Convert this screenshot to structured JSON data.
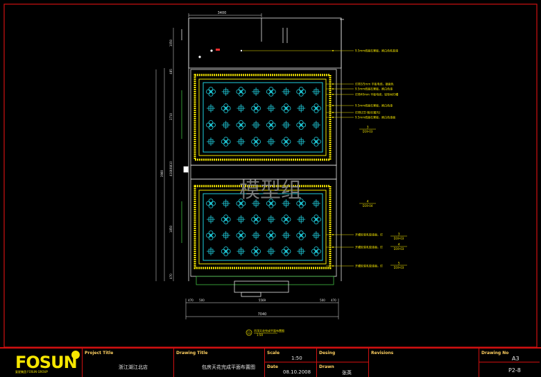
{
  "watermark": "模型组",
  "plan_title": "吊顶天花完成平面布置图",
  "plan_scale": "1:50",
  "plan_number": "11",
  "dimensions": {
    "top": "3400",
    "left": [
      "1050",
      "485",
      "3710",
      "410",
      "400",
      "410",
      "3980",
      "1850",
      "470"
    ],
    "bottom_segments": [
      "470",
      "500",
      "5569",
      "500",
      "470"
    ],
    "overall": "7040",
    "inner": "1170"
  },
  "annotations": [
    "9.5mm纸面石膏板，刷白色乳胶漆",
    "灯带3/5mm 平板电线，银面色",
    "9.5mm纸面石膏板，刷白色漆",
    "灯带40mm 平板电线，铝型材灯槽",
    "9.5mm纸面石膏板，刷白色漆",
    "灯带LED 暗光(暖光)",
    "9.5mm纸面石膏板，刷白色漆面",
    "开槽安装乳胶漆面，灯",
    "开槽安装乳胶漆面，灯",
    "开槽安装乳胶漆面，灯"
  ],
  "callouts": [
    {
      "num": "3",
      "sheet": "D19-03"
    },
    {
      "num": "4",
      "sheet": "D19-04"
    },
    {
      "num": "3",
      "sheet": "D19-03"
    },
    {
      "num": "4",
      "sheet": "D19-03"
    },
    {
      "num": "5",
      "sheet": "D19-03"
    }
  ],
  "title_block": {
    "logo": "FOSUN",
    "logo_sub": "复星集团 FOSUN GROUP",
    "project_title_label": "Project Title",
    "project_title": "浙江湖江北店",
    "drawing_title_label": "Drawing  Title",
    "drawing_title": "包房天花完成平面布置图",
    "scale_label": "Scale",
    "scale": "1:50",
    "date_label": "Date",
    "date": "08.10.2008",
    "design_label": "Desing",
    "design": "",
    "drawn_label": "Drawn",
    "drawn": "张英",
    "revisions_label": "Revisions",
    "drawing_no_label": "Drawing No",
    "sheet_size": "A3",
    "drawing_no": "P2-8"
  },
  "colors": {
    "background": "#000000",
    "border": "#d01010",
    "yellow": "#f5e600",
    "cyan": "#20d0e0",
    "green": "#40c040",
    "dim": "#e8e8e8"
  }
}
